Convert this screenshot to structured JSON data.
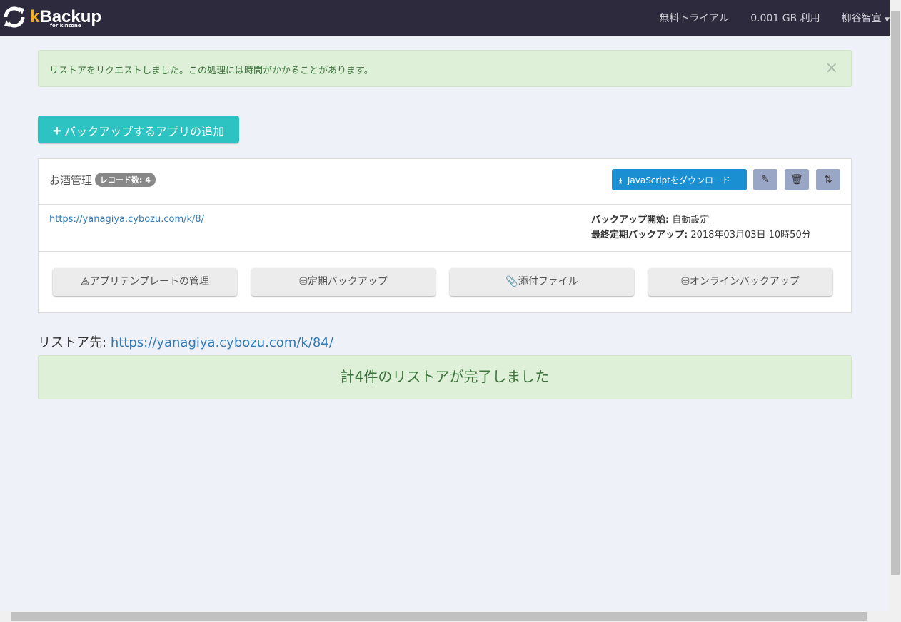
{
  "nav": {
    "brand_k": "k",
    "brand_rest": "Backup",
    "brand_sub": "for kintone",
    "trial": "無料トライアル",
    "usage": "0.001 GB 利用",
    "user": "柳谷智宣"
  },
  "alert": {
    "message": "リストアをリクエストしました。この処理には時間がかかることがあります。",
    "close": "×"
  },
  "add_button": "バックアップするアプリの追加",
  "app": {
    "name": "お酒管理",
    "record_badge": "レコード数: 4",
    "download_label": "JavaScriptをダウンロード",
    "url": "https://yanagiya.cybozu.com/k/8/",
    "backup_start_label": "バックアップ開始:",
    "backup_start_value": "自動設定",
    "last_backup_label": "最終定期バックアップ:",
    "last_backup_value": "2018年03月03日 10時50分",
    "actions": [
      "アプリテンプレートの管理",
      "定期バックアップ",
      "添付ファイル",
      "オンラインバックアップ"
    ]
  },
  "restore": {
    "label": "リストア先:",
    "url": "https://yanagiya.cybozu.com/k/84/",
    "done": "計4件のリストアが完了しました"
  }
}
